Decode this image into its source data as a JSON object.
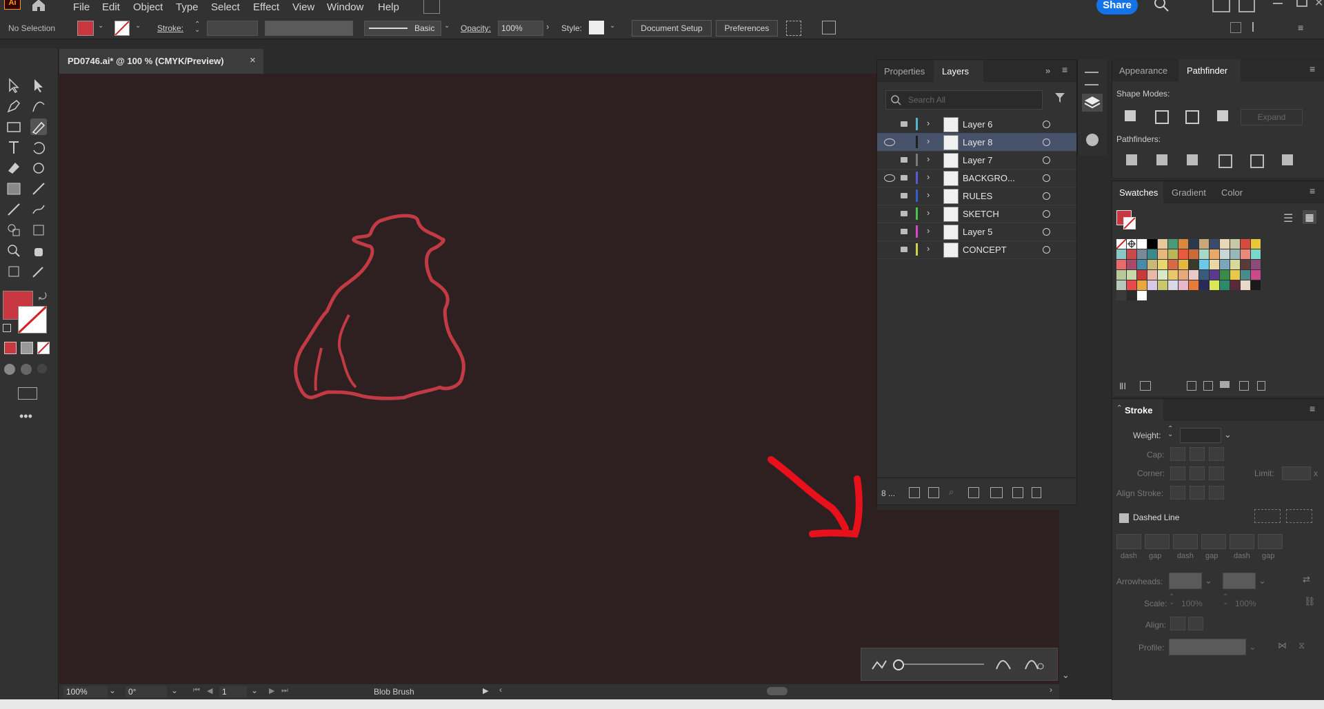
{
  "app": {
    "logo": "Ai"
  },
  "menu": [
    "File",
    "Edit",
    "Object",
    "Type",
    "Select",
    "Effect",
    "View",
    "Window",
    "Help"
  ],
  "share_label": "Share",
  "control_bar": {
    "selection": "No Selection",
    "stroke_label": "Stroke:",
    "brush_label": "Basic",
    "opacity_label": "Opacity:",
    "opacity_value": "100%",
    "style_label": "Style:",
    "document_setup": "Document Setup",
    "preferences": "Preferences",
    "fill_color": "#c8373f"
  },
  "document": {
    "tab_title": "PD0746.ai* @ 100 % (CMYK/Preview)",
    "close": "×"
  },
  "status_bar": {
    "zoom": "100%",
    "rotation": "0°",
    "artboard": "1",
    "tool": "Blob Brush"
  },
  "layers_panel": {
    "tabs": [
      "Properties",
      "Layers"
    ],
    "search_placeholder": "Search All",
    "layers": [
      {
        "name": "Layer 6",
        "visible": false,
        "locked": true,
        "color": "#4fb8c9",
        "selected": false
      },
      {
        "name": "Layer 8",
        "visible": true,
        "locked": false,
        "color": "#1e1e1e",
        "selected": true
      },
      {
        "name": "Layer 7",
        "visible": false,
        "locked": true,
        "color": "#7a7a7a",
        "selected": false
      },
      {
        "name": "BACKGRO...",
        "visible": true,
        "locked": true,
        "color": "#5a5ad0",
        "selected": false
      },
      {
        "name": "RULES",
        "visible": false,
        "locked": true,
        "color": "#3a5ad0",
        "selected": false
      },
      {
        "name": "SKETCH",
        "visible": false,
        "locked": true,
        "color": "#4ac54a",
        "selected": false
      },
      {
        "name": "Layer 5",
        "visible": false,
        "locked": true,
        "color": "#d04ad0",
        "selected": false
      },
      {
        "name": "CONCEPT",
        "visible": false,
        "locked": true,
        "color": "#d0d04a",
        "selected": false
      }
    ],
    "layer_count": "8 ..."
  },
  "appearance_panel": {
    "tabs": [
      "Appearance",
      "Pathfinder"
    ],
    "shape_modes_label": "Shape Modes:",
    "expand_label": "Expand",
    "pathfinders_label": "Pathfinders:"
  },
  "swatches_panel": {
    "tabs": [
      "Swatches",
      "Gradient",
      "Color"
    ],
    "colors": [
      "none",
      "reg",
      "#ffffff",
      "#000000",
      "#e8c79a",
      "#4a9a7a",
      "#d88a3a",
      "#2a3a4a",
      "#c8a87a",
      "#3a4a6a",
      "#e8d8b8",
      "#c8c8a8",
      "#d84a3a",
      "#e8c83a",
      "#8ac8c8",
      "#c84a4a",
      "#7a8a9a",
      "#3a8a8a",
      "#e8b87a",
      "#b8b85a",
      "#e85a3a",
      "#c86a3a",
      "#a8d8c8",
      "#e8a86a",
      "#c8d8d8",
      "#9ab8b8",
      "#e88a7a",
      "#7ad8c8",
      "#e86a6a",
      "#aa4a6a",
      "#4a8aaa",
      "#c8b87a",
      "#e8d86a",
      "#d86a4a",
      "#e8b83a",
      "#3a3a2a",
      "#6ac8e8",
      "#e8d8a8",
      "#7aa8b8",
      "#d8d89a",
      "#5a3a3a",
      "#8a4a7a",
      "#b8c89a",
      "#c8d8aa",
      "#c83a3a",
      "#e8b8a8",
      "#d8e8c8",
      "#e8c86a",
      "#e8a87a",
      "#e8c8c8",
      "#3a5a7a",
      "#5a3a8a",
      "#3a8a4a",
      "#e8c84a",
      "#4a8a8a",
      "#c84a8a",
      "#b8c8b8",
      "#e84a4a",
      "#e8a83a",
      "#d8c8e8",
      "#c8c86a",
      "#d8d8e8",
      "#e8b8c8",
      "#e87a3a",
      "#2a2a5a",
      "#d8e85a",
      "#2a8a6a",
      "#5a2a3a",
      "#e8d8c8",
      "#1a1a1a",
      "#3a3a3a",
      "#2a2a2a",
      "#ffffff"
    ]
  },
  "stroke_panel": {
    "title": "Stroke",
    "weight_label": "Weight:",
    "cap_label": "Cap:",
    "corner_label": "Corner:",
    "limit_label": "Limit:",
    "limit_x": "x",
    "align_stroke_label": "Align Stroke:",
    "dashed_line_label": "Dashed Line",
    "dash_labels": [
      "dash",
      "gap",
      "dash",
      "gap",
      "dash",
      "gap"
    ],
    "arrowheads_label": "Arrowheads:",
    "scale_label": "Scale:",
    "scale_value_1": "100%",
    "scale_value_2": "100%",
    "align_label": "Align:",
    "profile_label": "Profile:"
  }
}
